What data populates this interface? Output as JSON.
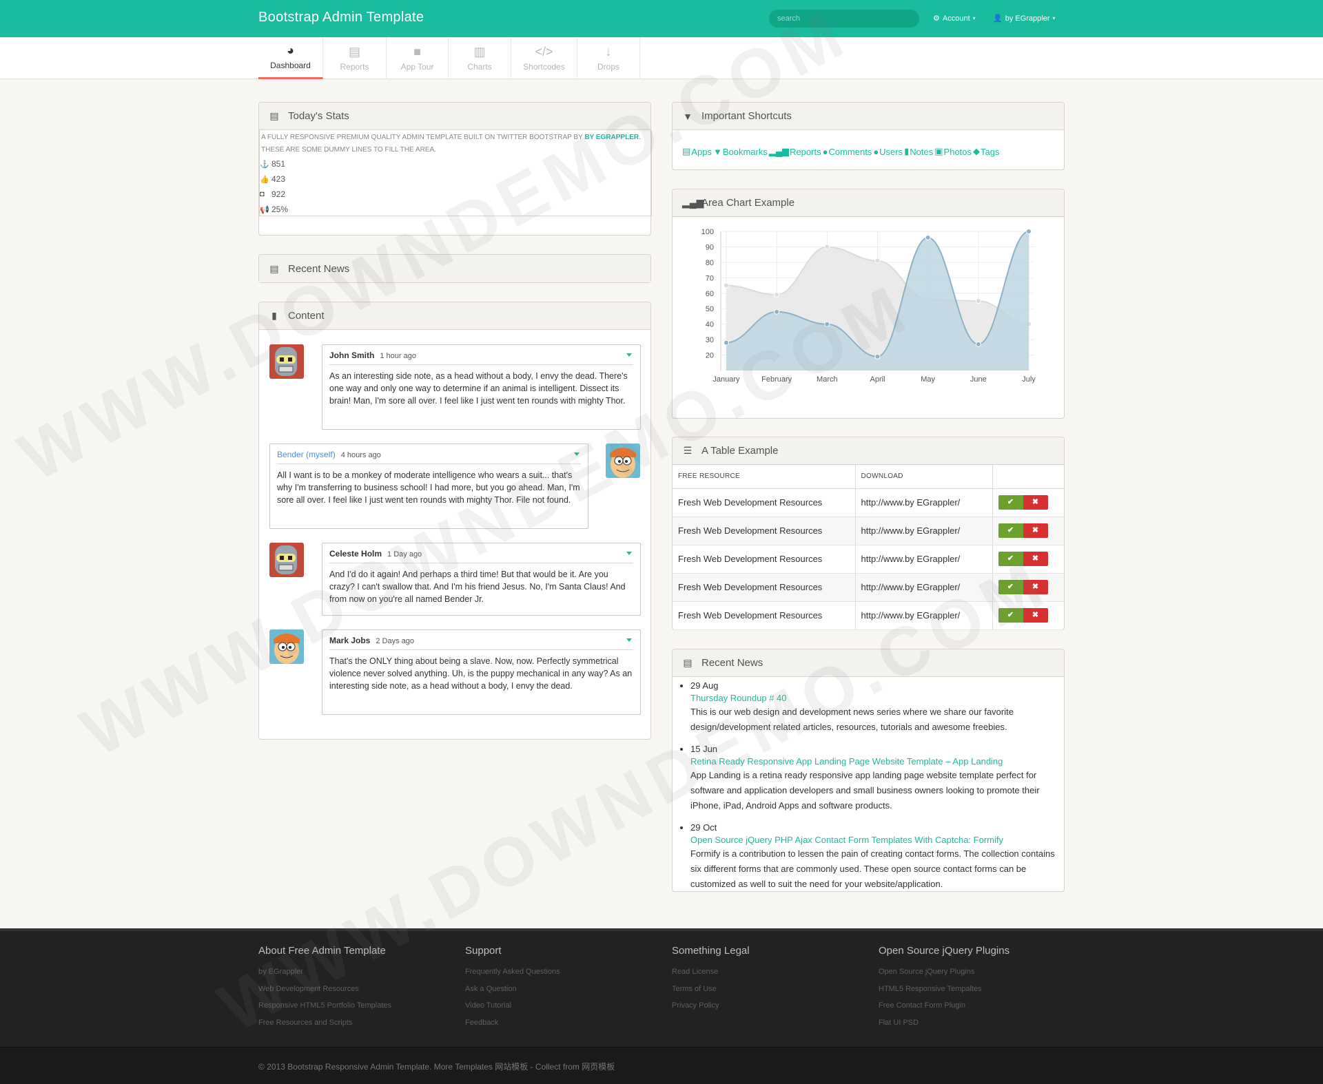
{
  "header": {
    "brand": "Bootstrap Admin Template",
    "search_placeholder": "search",
    "account_label": "Account",
    "user_label": "by EGrappler"
  },
  "nav": {
    "tabs": [
      {
        "label": "Dashboard",
        "icon": "dashboard-icon",
        "active": true
      },
      {
        "label": "Reports",
        "icon": "list-alt-icon"
      },
      {
        "label": "App Tour",
        "icon": "facetime-video-icon"
      },
      {
        "label": "Charts",
        "icon": "bar-chart-icon"
      },
      {
        "label": "Shortcodes",
        "icon": "code-icon"
      },
      {
        "label": "Drops",
        "icon": "long-arrow-down-icon"
      }
    ]
  },
  "stats": {
    "title": "Today's Stats",
    "desc_prefix": "A fully responsive premium quality admin template built on Twitter Bootstrap by ",
    "desc_link": "by EGrappler",
    "desc_suffix": ". These are some dummy lines to fill the area.",
    "items": [
      {
        "icon": "anchor-icon",
        "value": "851"
      },
      {
        "icon": "thumbs-up-icon",
        "value": "423"
      },
      {
        "icon": "twitter-icon",
        "value": "922"
      },
      {
        "icon": "bullhorn-icon",
        "value": "25%"
      }
    ]
  },
  "recent_news_left": {
    "title": "Recent News"
  },
  "content": {
    "title": "Content",
    "messages": [
      {
        "name": "John Smith",
        "time": "1 hour ago",
        "text": "As an interesting side note, as a head without a body, I envy the dead. There's one way and only one way to determine if an animal is intelligent. Dissect its brain! Man, I'm sore all over. I feel like I just went ten rounds with mighty Thor."
      },
      {
        "name": "Bender (myself)",
        "time": "4 hours ago",
        "text": "All I want is to be a monkey of moderate intelligence who wears a suit... that's why I'm transferring to business school! I had more, but you go ahead. Man, I'm sore all over. I feel like I just went ten rounds with mighty Thor. File not found."
      },
      {
        "name": "Celeste Holm",
        "time": "1 Day ago",
        "text": "And I'd do it again! And perhaps a third time! But that would be it. Are you crazy? I can't swallow that. And I'm his friend Jesus. No, I'm Santa Claus! And from now on you're all named Bender Jr."
      },
      {
        "name": "Mark Jobs",
        "time": "2 Days ago",
        "text": "That's the ONLY thing about being a slave. Now, now. Perfectly symmetrical violence never solved anything. Uh, is the puppy mechanical in any way? As an interesting side note, as a head without a body, I envy the dead."
      }
    ]
  },
  "shortcuts": {
    "title": "Important Shortcuts",
    "items": [
      {
        "label": "Apps",
        "icon": "list-alt-icon"
      },
      {
        "label": "Bookmarks",
        "icon": "bookmark-icon"
      },
      {
        "label": "Reports",
        "icon": "signal-icon"
      },
      {
        "label": "Comments",
        "icon": "comment-icon"
      },
      {
        "label": "Users",
        "icon": "user-icon"
      },
      {
        "label": "Notes",
        "icon": "file-icon"
      },
      {
        "label": "Photos",
        "icon": "picture-icon"
      },
      {
        "label": "Tags",
        "icon": "tag-icon"
      }
    ]
  },
  "area_chart": {
    "title": "Area Chart Example"
  },
  "chart_data": {
    "type": "area",
    "categories": [
      "January",
      "February",
      "March",
      "April",
      "May",
      "June",
      "July"
    ],
    "y_ticks": [
      20,
      30,
      40,
      50,
      60,
      70,
      80,
      90,
      100
    ],
    "ylim": [
      10,
      100
    ],
    "series": [
      {
        "values": [
          65,
          59,
          90,
          81,
          56,
          55,
          40
        ],
        "fill": "#e8e8e8",
        "stroke": "#dcdcdc"
      },
      {
        "values": [
          28,
          48,
          40,
          19,
          96,
          27,
          100
        ],
        "fill": "#bed6e2",
        "stroke": "#8cb2c8"
      }
    ],
    "grid": true
  },
  "table": {
    "title": "A Table Example",
    "headers": [
      "FREE RESOURCE",
      "DOWNLOAD",
      ""
    ],
    "rows": [
      [
        "Fresh Web Development Resources",
        "http://www.by EGrappler/"
      ],
      [
        "Fresh Web Development Resources",
        "http://www.by EGrappler/"
      ],
      [
        "Fresh Web Development Resources",
        "http://www.by EGrappler/"
      ],
      [
        "Fresh Web Development Resources",
        "http://www.by EGrappler/"
      ],
      [
        "Fresh Web Development Resources",
        "http://www.by EGrappler/"
      ]
    ],
    "ok_icon": "check-icon",
    "remove_icon": "remove-icon"
  },
  "news": {
    "title": "Recent News",
    "items": [
      {
        "date": "29 Aug",
        "link": "Thursday Roundup # 40",
        "text": "This is our web design and development news series where we share our favorite design/development related articles, resources, tutorials and awesome freebies."
      },
      {
        "date": "15 Jun",
        "link": "Retina Ready Responsive App Landing Page Website Template – App Landing",
        "text": "App Landing is a retina ready responsive app landing page website template perfect for software and application developers and small business owners looking to promote their iPhone, iPad, Android Apps and software products."
      },
      {
        "date": "29 Oct",
        "link": "Open Source jQuery PHP Ajax Contact Form Templates With Captcha: Formify",
        "text": "Formify is a contribution to lessen the pain of creating contact forms. The collection contains six different forms that are commonly used. These open source contact forms can be customized as well to suit the need for your website/application."
      }
    ]
  },
  "footer": {
    "columns": [
      {
        "title": "About Free Admin Template",
        "links": [
          "by EGrappler",
          "Web Development Resources",
          "Responsive HTML5 Portfolio Templates",
          "Free Resources and Scripts"
        ]
      },
      {
        "title": "Support",
        "links": [
          "Frequently Asked Questions",
          "Ask a Question",
          "Video Tutorial",
          "Feedback"
        ]
      },
      {
        "title": "Something Legal",
        "links": [
          "Read License",
          "Terms of Use",
          "Privacy Policy"
        ]
      },
      {
        "title": "Open Source jQuery Plugins",
        "links": [
          "Open Source jQuery Plugins",
          "HTML5 Responsive Tempaltes",
          "Free Contact Form Plugin",
          "Flat UI PSD"
        ]
      }
    ],
    "copyright": "© 2013 Bootstrap Responsive Admin Template. More Templates 网站模板 - Collect from 网页模板"
  },
  "watermark": "WWW.DOWNDEMO.COM",
  "colors": {
    "accent": "#19bc9c",
    "ok": "#6ca12e",
    "danger": "#d73030",
    "active_tab": "#f36a5a"
  }
}
